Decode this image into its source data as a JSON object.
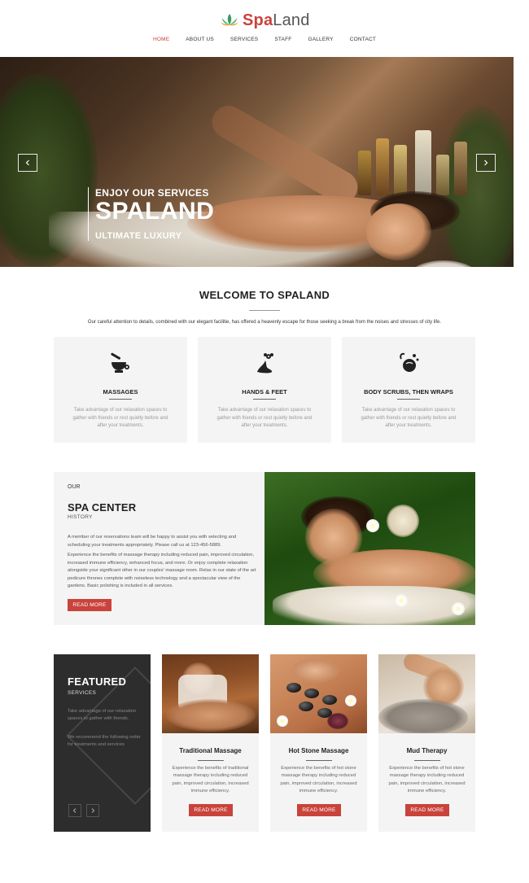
{
  "header": {
    "logo": {
      "part1": "Spa",
      "part2": "Land",
      "icon": "lotus-icon"
    },
    "nav": [
      {
        "label": "HOME",
        "active": true
      },
      {
        "label": "ABOUT US",
        "active": false
      },
      {
        "label": "SERVICES",
        "active": false
      },
      {
        "label": "STAFF",
        "active": false
      },
      {
        "label": "GALLERY",
        "active": false
      },
      {
        "label": "CONTACT",
        "active": false
      }
    ]
  },
  "hero": {
    "kicker": "ENJOY OUR SERVICES",
    "title": "SPALAND",
    "subtitle": "ULTIMATE LUXURY",
    "prev_icon": "chevron-left-icon",
    "next_icon": "chevron-right-icon"
  },
  "welcome": {
    "title": "WELCOME TO SPALAND",
    "text": "Our careful attention to details, combined with our elegant facilitie, has offered a heavenly escape for those seeking a break from the noises and stresses of city life."
  },
  "features": [
    {
      "icon": "mortar-pestle-icon",
      "title": "MASSAGES",
      "desc": "Take advantage of our relaxation spaces to gather with friends or rest quietly before and after your treatments."
    },
    {
      "icon": "foot-flower-icon",
      "title": "HANDS & FEET",
      "desc": "Take advantage of our relaxation spaces to gather with friends or rest quietly before and after your treatments."
    },
    {
      "icon": "body-scrub-icon",
      "title": "BODY SCRUBS, THEN WRAPS",
      "desc": "Take advantage of our relaxation spaces to gather with friends or rest quietly before and after your treatments."
    }
  ],
  "center": {
    "kicker": "OUR",
    "title": "SPA CENTER",
    "subtitle": "HISTORY",
    "p1": "A member of our reservations team will be happy to assist you with selecting and scheduling your treatments appropriately. Please call us at 123-456-5889.",
    "p2": "Experience the benefits of massage therapy including reduced pain, improved circulation, increased immune efficiency, enhanced focus, and more. Or enjoy complete relaxation alongside your significant other in our couples' massage room. Relax in our state of the art pedicure thrones complete with noiseless technology and a spectacular view of the gardens. Basic polishing is included in all services.",
    "button": "READ MORE"
  },
  "featured": {
    "title": "FEATURED",
    "subtitle": "SERVICES",
    "p1": "Take advantage of our relaxation spaces to gather with friends.",
    "p2": "We recommend the following order for treatments and services",
    "prev_icon": "chevron-left-icon",
    "next_icon": "chevron-right-icon"
  },
  "services": [
    {
      "title": "Traditional Massage",
      "desc": "Experience the benefits of traditional massage therapy including reduced pain, improved circulation, increased immune efficiency.",
      "button": "READ MORE"
    },
    {
      "title": "Hot Stone Massage",
      "desc": "Experience the benefits of hot stone massage therapy including reduced pain, improved circulation, increased immune efficiency.",
      "button": "READ MORE"
    },
    {
      "title": "Mud Therapy",
      "desc": "Experience the benefits of hot stone massage therapy including reduced pain, improved circulation, increased immune efficiency.",
      "button": "READ MORE"
    }
  ],
  "colors": {
    "accent": "#c9433b",
    "dark_panel": "#2d2d2d",
    "light_panel": "#f4f4f4",
    "logo_green": "#3a9d5d"
  }
}
